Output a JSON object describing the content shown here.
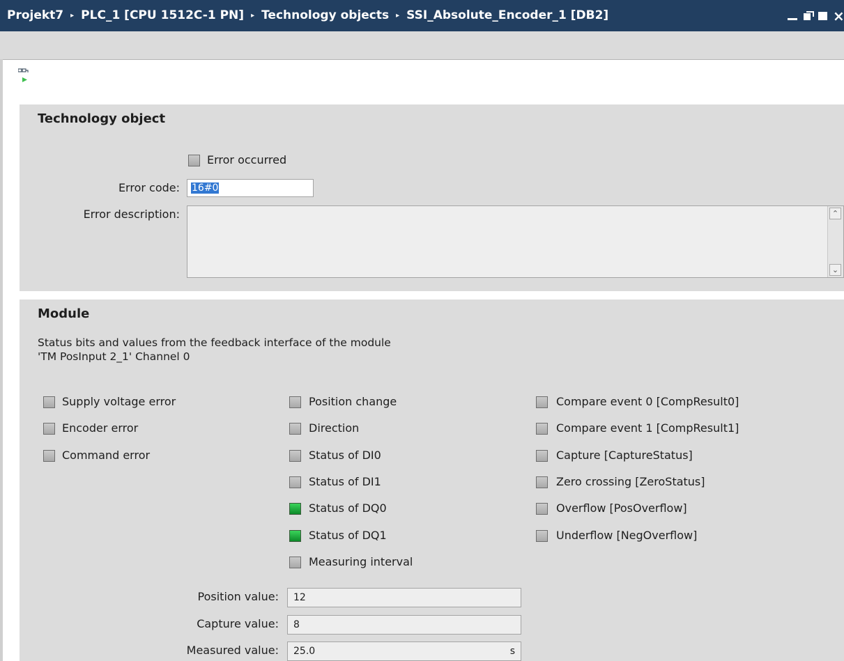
{
  "titlebar": {
    "crumbs": [
      "Projekt7",
      "PLC_1 [CPU 1512C-1 PN]",
      "Technology objects",
      "SSI_Absolute_Encoder_1 [DB2]"
    ],
    "separator": "▸",
    "close_glyph": "×"
  },
  "toolbar": {
    "monitor_icon": "monitor-all-icon"
  },
  "technology_object": {
    "title": "Technology object",
    "error_occurred_label": "Error occurred",
    "error_occurred": false,
    "error_code_label": "Error code:",
    "error_code_value": "16#0",
    "error_description_label": "Error description:",
    "error_description_value": "",
    "scroll_up": "⌃",
    "scroll_down": "⌄"
  },
  "module": {
    "title": "Module",
    "info_line1": "Status bits and values from the feedback interface of the module",
    "info_line2": "'TM PosInput 2_1' Channel 0",
    "col1": [
      {
        "label": "Supply voltage error",
        "on": false
      },
      {
        "label": "Encoder error",
        "on": false
      },
      {
        "label": "Command error",
        "on": false
      }
    ],
    "col2": [
      {
        "label": "Position change",
        "on": false
      },
      {
        "label": "Direction",
        "on": false
      },
      {
        "label": "Status of DI0",
        "on": false
      },
      {
        "label": "Status of DI1",
        "on": false
      },
      {
        "label": "Status of DQ0",
        "on": true
      },
      {
        "label": "Status of DQ1",
        "on": true
      },
      {
        "label": "Measuring interval",
        "on": false
      }
    ],
    "col3": [
      {
        "label": "Compare event 0 [CompResult0]",
        "on": false
      },
      {
        "label": "Compare event 1 [CompResult1]",
        "on": false
      },
      {
        "label": "Capture [CaptureStatus]",
        "on": false
      },
      {
        "label": "Zero crossing [ZeroStatus]",
        "on": false
      },
      {
        "label": "Overflow [PosOverflow]",
        "on": false
      },
      {
        "label": "Underflow [NegOverflow]",
        "on": false
      }
    ],
    "position_label": "Position value:",
    "position_value": "12",
    "capture_label": "Capture value:",
    "capture_value": "8",
    "measured_label": "Measured value:",
    "measured_value": "25.0",
    "measured_unit": "s"
  }
}
